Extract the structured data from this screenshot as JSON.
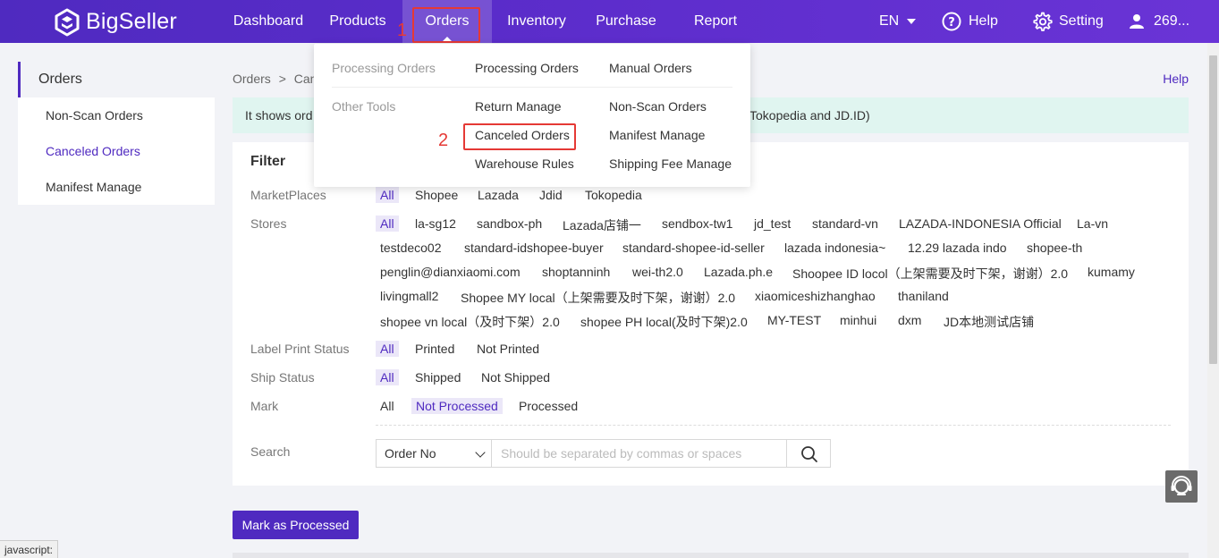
{
  "brand": {
    "name": "BigSeller"
  },
  "nav": {
    "items": [
      "Dashboard",
      "Products",
      "Orders",
      "Inventory",
      "Purchase",
      "Report"
    ],
    "language": "EN",
    "help": "Help",
    "setting": "Setting",
    "user": "269..."
  },
  "annotations": {
    "step1": "1",
    "step2": "2"
  },
  "sidebar": {
    "header": "Orders",
    "items": [
      "Non-Scan Orders",
      "Canceled Orders",
      "Manifest Manage"
    ]
  },
  "breadcrumb": {
    "root": "Orders",
    "sep": ">",
    "current": "Canc"
  },
  "help_link": "Help",
  "notice": {
    "lead": "It shows ord",
    "tail": "Tokopedia and JD.ID)"
  },
  "filter": {
    "title": "Filter",
    "marketplaces": {
      "label": "MarketPlaces",
      "options": [
        "All",
        "Shopee",
        "Lazada",
        "Jdid",
        "Tokopedia"
      ]
    },
    "stores": {
      "label": "Stores",
      "options": [
        "All",
        "la-sg12",
        "sandbox-ph",
        "Lazada店铺一",
        "sendbox-tw1",
        "jd_test",
        "standard-vn",
        "LAZADA-INDONESIA Official",
        "La-vn",
        "testdeco02",
        "standard-idshopee-buyer",
        "standard-shopee-id-seller",
        "lazada indonesia~",
        "12.29 lazada indo",
        "shopee-th",
        "penglin@dianxiaomi.com",
        "shoptanninh",
        "wei-th2.0",
        "Lazada.ph.e",
        "Shoopee ID locol（上架需要及时下架，谢谢）2.0",
        "kumamy",
        "livingmall2",
        "Shopee MY local（上架需要及时下架，谢谢）2.0",
        "xiaomiceshizhanghao",
        "thaniland",
        "shopee vn local（及时下架）2.0",
        "shopee PH local(及时下架)2.0",
        "MY-TEST",
        "minhui",
        "dxm",
        "JD本地测试店铺"
      ]
    },
    "label_print": {
      "label": "Label Print Status",
      "options": [
        "All",
        "Printed",
        "Not Printed"
      ]
    },
    "ship_status": {
      "label": "Ship Status",
      "options": [
        "All",
        "Shipped",
        "Not Shipped"
      ]
    },
    "mark": {
      "label": "Mark",
      "options": [
        "All",
        "Not Processed",
        "Processed"
      ]
    },
    "search": {
      "label": "Search",
      "field": "Order No",
      "placeholder": "Should be separated by commas or spaces"
    }
  },
  "actions": {
    "mark_processed": "Mark as Processed"
  },
  "dropdown": {
    "group1": "Processing Orders",
    "group2": "Other Tools",
    "col1": [
      "Processing Orders",
      "Return Manage",
      "Canceled Orders",
      "Warehouse Rules"
    ],
    "col2": [
      "Manual Orders",
      "Non-Scan Orders",
      "Manifest Manage",
      "Shipping Fee Manage"
    ]
  },
  "status_bar": "javascript:",
  "colors": {
    "brand": "#4f2ac0",
    "annotation": "#e53935",
    "notice_bg": "#e0f5f0"
  }
}
